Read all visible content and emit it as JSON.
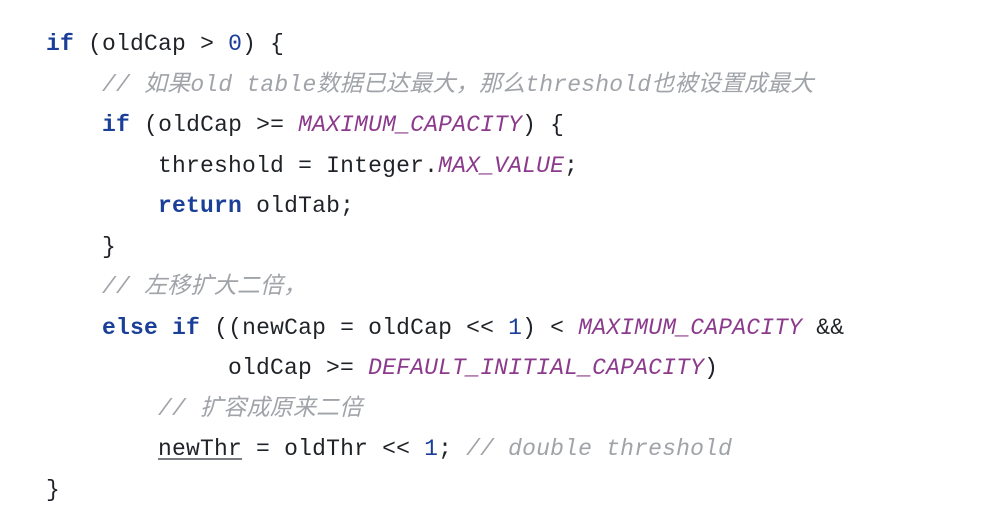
{
  "code": {
    "lines": [
      {
        "tokens": [
          {
            "t": "if",
            "c": "k"
          },
          {
            "t": " ",
            "c": ""
          },
          {
            "t": "(",
            "c": "br"
          },
          {
            "t": "oldCap",
            "c": "id"
          },
          {
            "t": " > ",
            "c": "op"
          },
          {
            "t": "0",
            "c": "num"
          },
          {
            "t": ")",
            "c": "br"
          },
          {
            "t": " {",
            "c": "br"
          }
        ],
        "indent": 0
      },
      {
        "tokens": [
          {
            "t": "// 如果old table数据已达最大，那么threshold也被设置成最大",
            "c": "cm"
          }
        ],
        "indent": 1
      },
      {
        "tokens": [
          {
            "t": "if",
            "c": "k"
          },
          {
            "t": " ",
            "c": ""
          },
          {
            "t": "(",
            "c": "br"
          },
          {
            "t": "oldCap",
            "c": "id"
          },
          {
            "t": " >= ",
            "c": "op"
          },
          {
            "t": "MAXIMUM_CAPACITY",
            "c": "const"
          },
          {
            "t": ")",
            "c": "br"
          },
          {
            "t": " {",
            "c": "br"
          }
        ],
        "indent": 1
      },
      {
        "tokens": [
          {
            "t": "threshold",
            "c": "id"
          },
          {
            "t": " = ",
            "c": "op"
          },
          {
            "t": "Integer",
            "c": "cls"
          },
          {
            "t": ".",
            "c": "op"
          },
          {
            "t": "MAX_VALUE",
            "c": "const"
          },
          {
            "t": ";",
            "c": "op"
          }
        ],
        "indent": 2
      },
      {
        "tokens": [
          {
            "t": "return",
            "c": "k"
          },
          {
            "t": " ",
            "c": ""
          },
          {
            "t": "oldTab",
            "c": "id"
          },
          {
            "t": ";",
            "c": "op"
          }
        ],
        "indent": 2
      },
      {
        "tokens": [
          {
            "t": "}",
            "c": "br"
          }
        ],
        "indent": 1
      },
      {
        "tokens": [
          {
            "t": "// 左移扩大二倍，",
            "c": "cm"
          }
        ],
        "indent": 1
      },
      {
        "tokens": [
          {
            "t": "else if",
            "c": "k"
          },
          {
            "t": " ",
            "c": ""
          },
          {
            "t": "((",
            "c": "br"
          },
          {
            "t": "newCap",
            "c": "id"
          },
          {
            "t": " = ",
            "c": "op"
          },
          {
            "t": "oldCap",
            "c": "id"
          },
          {
            "t": " << ",
            "c": "op"
          },
          {
            "t": "1",
            "c": "num"
          },
          {
            "t": ")",
            "c": "br"
          },
          {
            "t": " < ",
            "c": "op"
          },
          {
            "t": "MAXIMUM_CAPACITY",
            "c": "const"
          },
          {
            "t": " &&",
            "c": "op"
          }
        ],
        "indent": 1
      },
      {
        "tokens": [
          {
            "t": "oldCap",
            "c": "id"
          },
          {
            "t": " >= ",
            "c": "op"
          },
          {
            "t": "DEFAULT_INITIAL_CAPACITY",
            "c": "const"
          },
          {
            "t": ")",
            "c": "br"
          }
        ],
        "indent": 3.25
      },
      {
        "tokens": [
          {
            "t": "// 扩容成原来二倍",
            "c": "cm"
          }
        ],
        "indent": 2
      },
      {
        "tokens": [
          {
            "t": "newThr",
            "c": "id under"
          },
          {
            "t": " = ",
            "c": "op"
          },
          {
            "t": "oldThr",
            "c": "id"
          },
          {
            "t": " << ",
            "c": "op"
          },
          {
            "t": "1",
            "c": "num"
          },
          {
            "t": "; ",
            "c": "op"
          },
          {
            "t": "// double threshold",
            "c": "cm"
          }
        ],
        "indent": 2
      },
      {
        "tokens": [
          {
            "t": "}",
            "c": "br"
          }
        ],
        "indent": 0
      }
    ]
  },
  "style": {
    "indent_unit": "    "
  }
}
